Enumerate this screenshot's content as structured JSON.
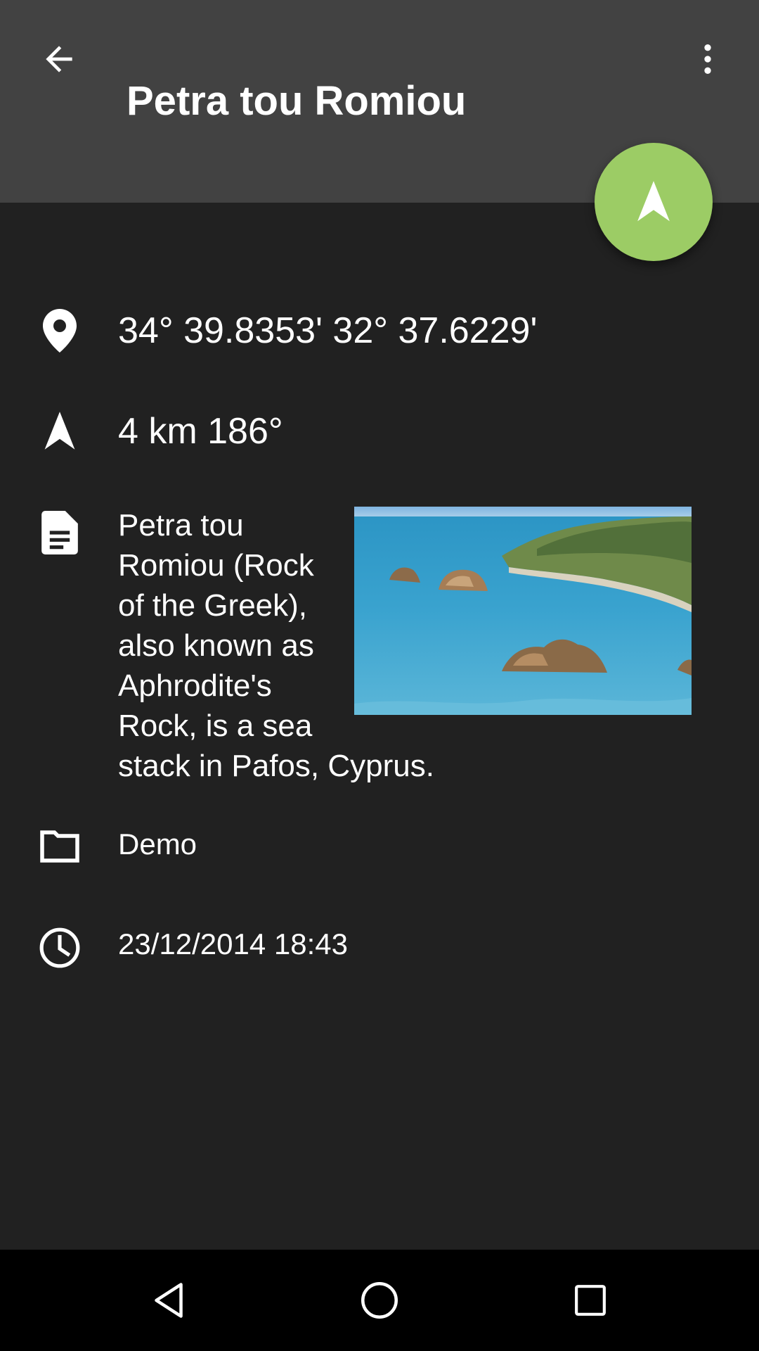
{
  "toolbar": {
    "title": "Petra tou Romiou",
    "back_icon": "arrow-back-icon",
    "menu_icon": "more-vert-icon"
  },
  "fab": {
    "icon": "navigation-icon",
    "color": "#9ccc65"
  },
  "details": {
    "coordinates": "34° 39.8353' 32° 37.6229'",
    "distance_bearing": "4 km 186°",
    "description_main": "Petra tou Romiou (Rock of the Greek), also known as Aphrodite's Rock, is a sea",
    "description_tail": "stack in Pafos, Cyprus.",
    "folder": "Demo",
    "timestamp": "23/12/2014 18:43"
  },
  "colors": {
    "appbar": "#424242",
    "background": "#212121",
    "accent": "#9ccc65"
  }
}
